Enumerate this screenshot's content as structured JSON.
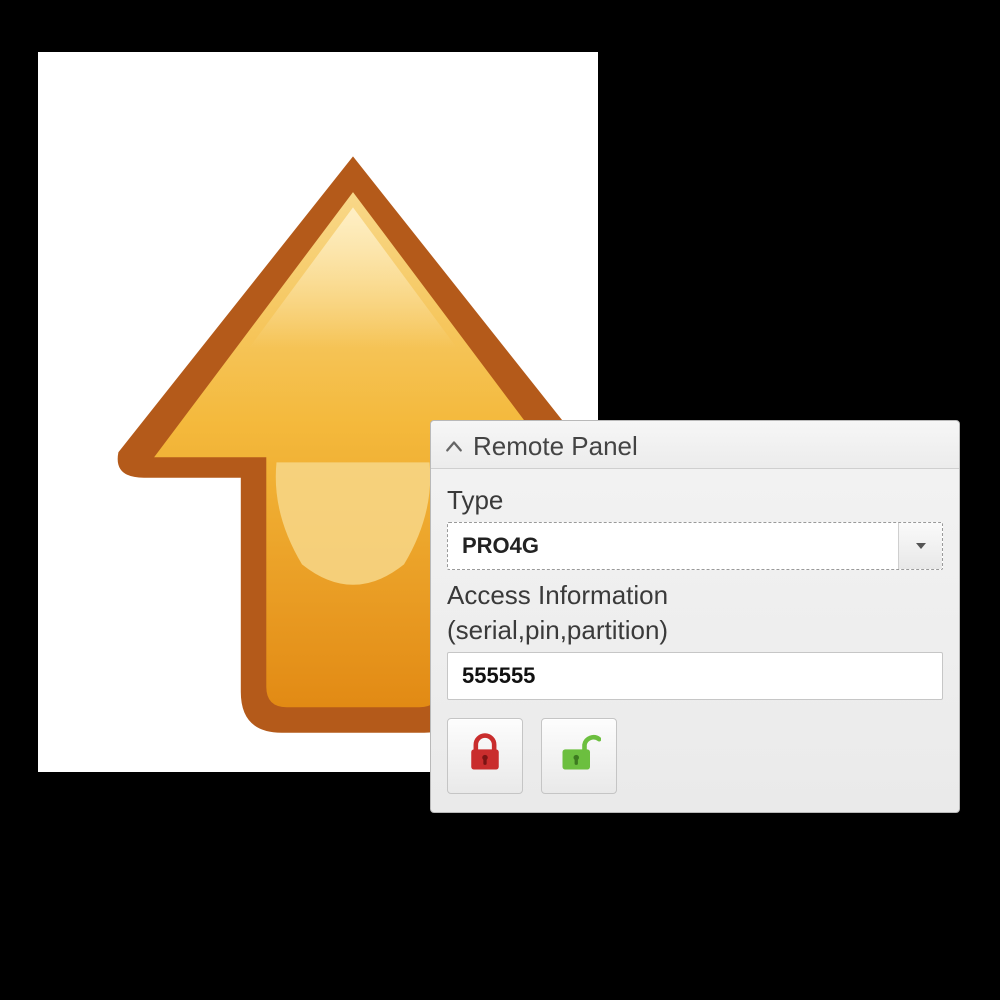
{
  "panel": {
    "title": "Remote Panel",
    "type_label": "Type",
    "type_value": "PRO4G",
    "access_label_line1": "Access Information",
    "access_label_line2": "(serial,pin,partition)",
    "access_value": "555555"
  },
  "icons": {
    "arrow": "upload-arrow-icon",
    "lock": "lock-icon",
    "unlock": "unlock-icon",
    "chevron_up": "chevron-up-icon",
    "caret_down": "caret-down-icon"
  },
  "colors": {
    "arrow_outline": "#b45a1a",
    "arrow_fill_light": "#f7cf6f",
    "arrow_fill_dark": "#e69a1f",
    "lock_red": "#c92d2d",
    "unlock_green": "#6cbf3f"
  }
}
